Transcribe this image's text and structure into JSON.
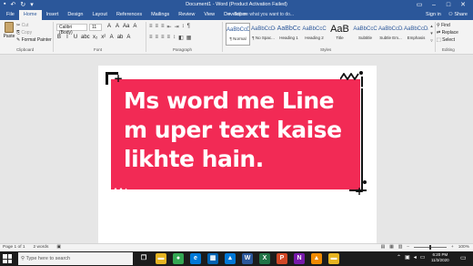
{
  "titlebar": {
    "title": "Document1 - Word (Product Activation Failed)",
    "qat": [
      {
        "icon": "save-icon",
        "glyph": "▪"
      },
      {
        "icon": "undo-icon",
        "glyph": "↶"
      },
      {
        "icon": "redo-icon",
        "glyph": "↻"
      },
      {
        "icon": "customize-qat-icon",
        "glyph": "▾"
      }
    ],
    "window_controls": [
      {
        "icon": "ribbon-display-icon",
        "glyph": "▭"
      },
      {
        "icon": "minimize-icon",
        "glyph": "–"
      },
      {
        "icon": "maximize-icon",
        "glyph": "□"
      },
      {
        "icon": "close-icon",
        "glyph": "✕"
      }
    ],
    "color": "#2b579a"
  },
  "tabs": [
    "File",
    "Home",
    "Insert",
    "Design",
    "Layout",
    "References",
    "Mailings",
    "Review",
    "View",
    "Developer"
  ],
  "active_tab": "Home",
  "tell_me": "Tell me what you want to do...",
  "account": {
    "signin": "Sign in",
    "share": "Share"
  },
  "clipboard": {
    "paste": "Paste",
    "cut": "Cut",
    "copy": "Copy",
    "format_painter": "Format Painter",
    "label": "Clipboard"
  },
  "font": {
    "name": "Calibri (Body)",
    "size": "11",
    "label": "Font",
    "row1": [
      "A",
      "A",
      "Aa",
      "A"
    ],
    "row2": [
      "B",
      "I",
      "U",
      "abc",
      "x₂",
      "x²",
      "A",
      "ab",
      "A"
    ]
  },
  "paragraph": {
    "label": "Paragraph",
    "row1": [
      "≡",
      "≡",
      "≡",
      "⇤",
      "⇥",
      "↕",
      "¶"
    ],
    "row2": [
      "≡",
      "≡",
      "≡",
      "≡",
      "↕",
      "◧",
      "▦"
    ]
  },
  "styles": {
    "label": "Styles",
    "items": [
      {
        "preview": "AaBbCcDc",
        "name": "¶ Normal"
      },
      {
        "preview": "AaBbCcDc",
        "name": "¶ No Spac..."
      },
      {
        "preview": "AaBbCc",
        "name": "Heading 1"
      },
      {
        "preview": "AaBbCcC",
        "name": "Heading 2"
      },
      {
        "preview": "AaB",
        "name": "Title"
      },
      {
        "preview": "AaBbCcC",
        "name": "Subtitle"
      },
      {
        "preview": "AaBbCcDa",
        "name": "Subtle Em..."
      },
      {
        "preview": "AaBbCcDa",
        "name": "Emphasis"
      }
    ]
  },
  "editing": {
    "find": "Find",
    "replace": "Replace",
    "select": "Select",
    "label": "Editing"
  },
  "document": {
    "banner_text": "Ms word me Line m uper text kaise likhte hain.",
    "banner_color": "#f22a55"
  },
  "status": {
    "page": "Page 1 of 1",
    "words": "2 words",
    "zoom": "100%",
    "zoom_level": 0.5
  },
  "taskbar": {
    "search_placeholder": "Type here to search",
    "time": "6:20 PM",
    "date": "11/3/2020",
    "apps": [
      {
        "icon": "task-view-icon",
        "glyph": "❐",
        "color": "#1c1c1c"
      },
      {
        "icon": "folder-icon",
        "glyph": "▬",
        "color": "#e6b422"
      },
      {
        "icon": "chrome-icon",
        "glyph": "●",
        "color": "#34a853"
      },
      {
        "icon": "edge-icon",
        "glyph": "e",
        "color": "#0078d7"
      },
      {
        "icon": "store-icon",
        "glyph": "▦",
        "color": "#0063b1"
      },
      {
        "icon": "photos-icon",
        "glyph": "▲",
        "color": "#0078d7"
      },
      {
        "icon": "word-icon",
        "glyph": "W",
        "color": "#2b579a"
      },
      {
        "icon": "excel-icon",
        "glyph": "X",
        "color": "#217346"
      },
      {
        "icon": "powerpoint-icon",
        "glyph": "P",
        "color": "#d24726"
      },
      {
        "icon": "onenote-icon",
        "glyph": "N",
        "color": "#7719aa"
      },
      {
        "icon": "vlc-icon",
        "glyph": "▲",
        "color": "#f08a00"
      },
      {
        "icon": "folder2-icon",
        "glyph": "▬",
        "color": "#e6b422"
      }
    ],
    "tray": [
      {
        "icon": "chevron-up-icon",
        "glyph": "⌃"
      },
      {
        "icon": "network-icon",
        "glyph": "▣"
      },
      {
        "icon": "volume-icon",
        "glyph": "◂"
      },
      {
        "icon": "notification-icon",
        "glyph": "▭"
      }
    ]
  }
}
